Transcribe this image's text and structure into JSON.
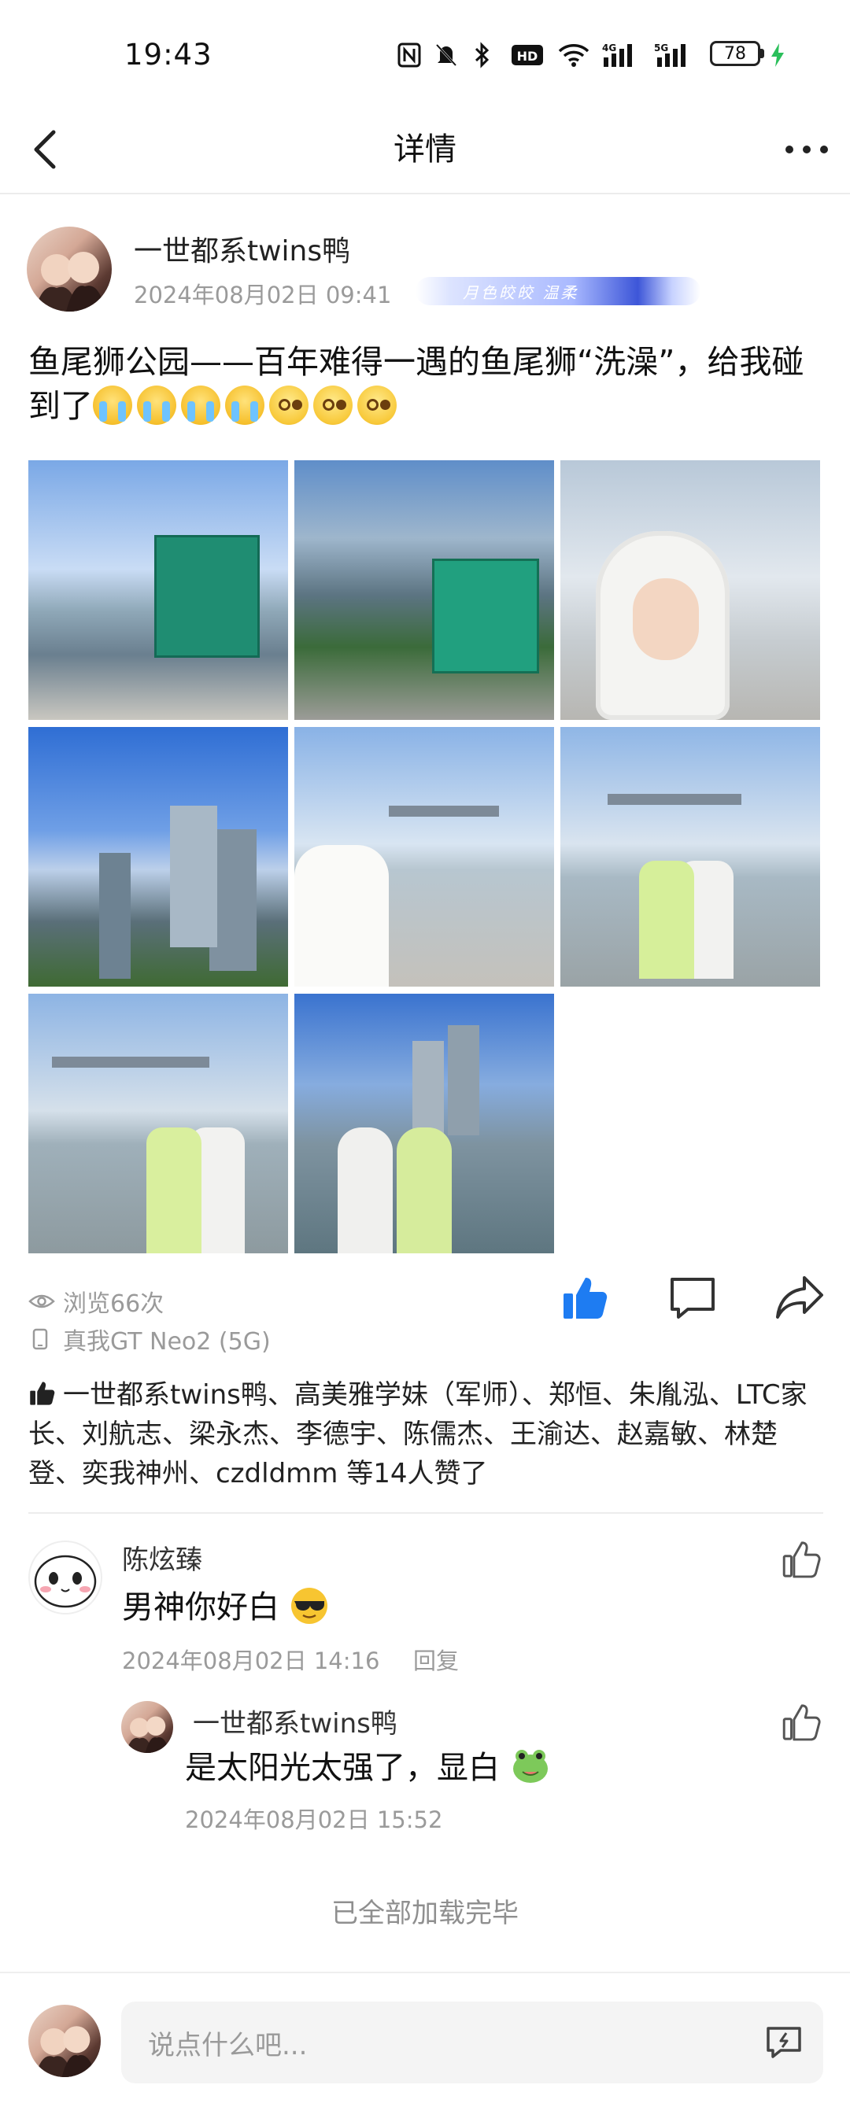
{
  "status_bar": {
    "time": "19:43",
    "battery": "78"
  },
  "nav": {
    "title": "详情"
  },
  "post": {
    "author": "一世都系twins鸭",
    "date": "2024年08月02日 09:41",
    "badge_text": "月色皎皎 温柔",
    "text": "鱼尾狮公园——百年难得一遇的鱼尾狮“洗澡”，给我碰到了",
    "emojis": [
      "cry",
      "cry",
      "cry",
      "cry",
      "dizzy",
      "dizzy",
      "dizzy"
    ],
    "photo_count": 8
  },
  "stats": {
    "views": "浏览66次",
    "device": "真我GT Neo2 (5G)"
  },
  "likes": {
    "text": "一世都系twins鸭、高美雅学妹（军师）、郑恒、朱胤泓、LTC家长、刘航志、梁永杰、李德宇、陈儒杰、王渝达、赵嘉敏、林楚登、奕我神州、czdldmm 等14人赞了"
  },
  "comments": [
    {
      "name": "陈炫臻",
      "text": "男神你好白",
      "emoji": "sunglasses",
      "date": "2024年08月02日 14:16",
      "reply_label": "回复",
      "replies": [
        {
          "name": "一世都系twins鸭",
          "text": "是太阳光太强了，显白",
          "emoji": "frog",
          "date": "2024年08月02日 15:52"
        }
      ]
    }
  ],
  "footer": {
    "loaded_text": "已全部加载完毕"
  },
  "input": {
    "placeholder": "说点什么吧..."
  },
  "colors": {
    "accent": "#1e7cf2",
    "muted": "#9a9a9a"
  }
}
